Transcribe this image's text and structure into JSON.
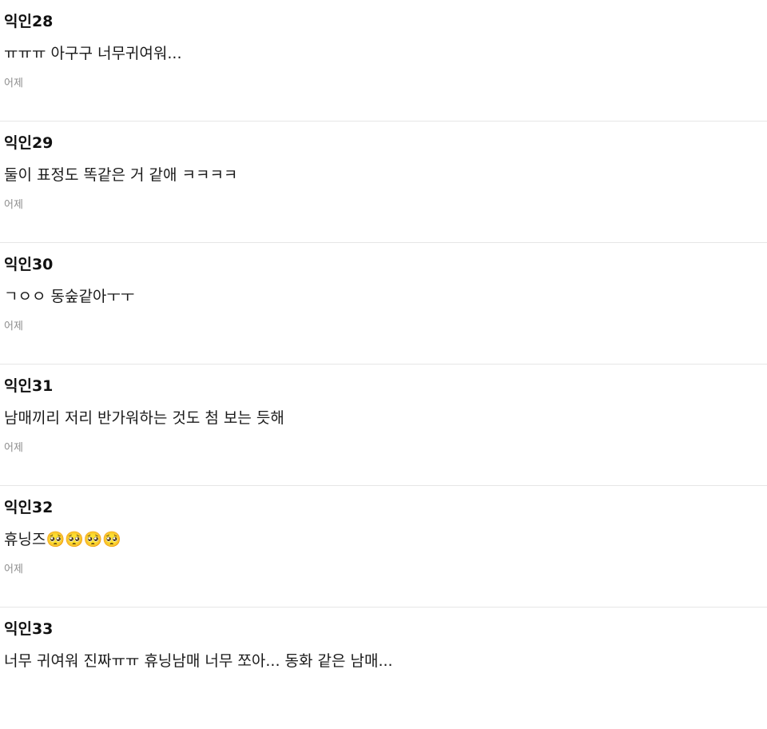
{
  "comments": [
    {
      "author": "익인28",
      "text": "ㅠㅠㅠ 아구구 너무귀여워...",
      "time": "어제"
    },
    {
      "author": "익인29",
      "text": "둘이 표정도 똑같은 거 같애 ㅋㅋㅋㅋ",
      "time": "어제"
    },
    {
      "author": "익인30",
      "text": "ㄱㅇㅇ 동숲같아ㅜㅜ",
      "time": "어제"
    },
    {
      "author": "익인31",
      "text": "남매끼리 저리 반가워하는 것도 첨 보는 듯해",
      "time": "어제"
    },
    {
      "author": "익인32",
      "text": "휴닝즈🥺🥺🥺🥺",
      "time": "어제"
    },
    {
      "author": "익인33",
      "text": "너무 귀여워 진짜ㅠㅠ 휴닝남매 너무 쪼아... 동화 같은 남매...",
      "time": ""
    }
  ]
}
